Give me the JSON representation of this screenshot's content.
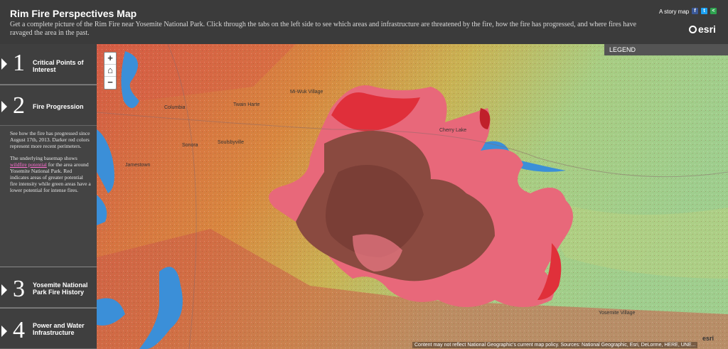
{
  "header": {
    "title": "Rim Fire Perspectives Map",
    "subtitle": "Get a complete picture of the Rim Fire near Yosemite National Park. Click through the tabs on the left side to see which areas and infrastructure are threatened by the fire, how the fire has progressed, and where fires have ravaged the area in the past.",
    "story_link": "A story map",
    "brand": "esri",
    "share_icons": [
      "facebook-icon",
      "twitter-icon",
      "share-icon"
    ]
  },
  "sidebar": {
    "tabs": [
      {
        "num": "1",
        "label": "Critical Points of Interest"
      },
      {
        "num": "2",
        "label": "Fire Progression"
      },
      {
        "num": "3",
        "label": "Yosemite National Park Fire History"
      },
      {
        "num": "4",
        "label": "Power and Water Infrastructure"
      }
    ],
    "active_body": {
      "p1": "See how the fire has progressed since August 17th, 2013. Darker red colors represent more recent perimeters.",
      "p2_pre": "The underlying basemap shows ",
      "p2_link": "wildfire potential",
      "p2_post": " for the area around Yosemite National Park. Red indicates areas of greater potential fire intensity while green areas have a lower potential for intense fires."
    }
  },
  "map": {
    "zoom_in": "+",
    "home": "⌂",
    "zoom_out": "−",
    "legend": "LEGEND",
    "attribution": "Content may not reflect National Geographic's current map policy. Sources: National Geographic, Esri, DeLorme, HERE, UNE...",
    "powered_by": "esri",
    "places": [
      "Columbia",
      "Twain Harte",
      "Mi-Wuk Village",
      "Sonora",
      "Soulsbyville",
      "Jamestown",
      "Yosemite Village",
      "Cherry Lake"
    ]
  },
  "colors": {
    "header_bg": "#3b3b3b",
    "sidebar_bg": "#404040",
    "fire_recent": "#e0303a",
    "fire_mid": "#e8687a",
    "fire_old": "#7a4038",
    "low_potential": "#a8d08a",
    "high_potential": "#d4664a",
    "water": "#3b8fd8"
  }
}
